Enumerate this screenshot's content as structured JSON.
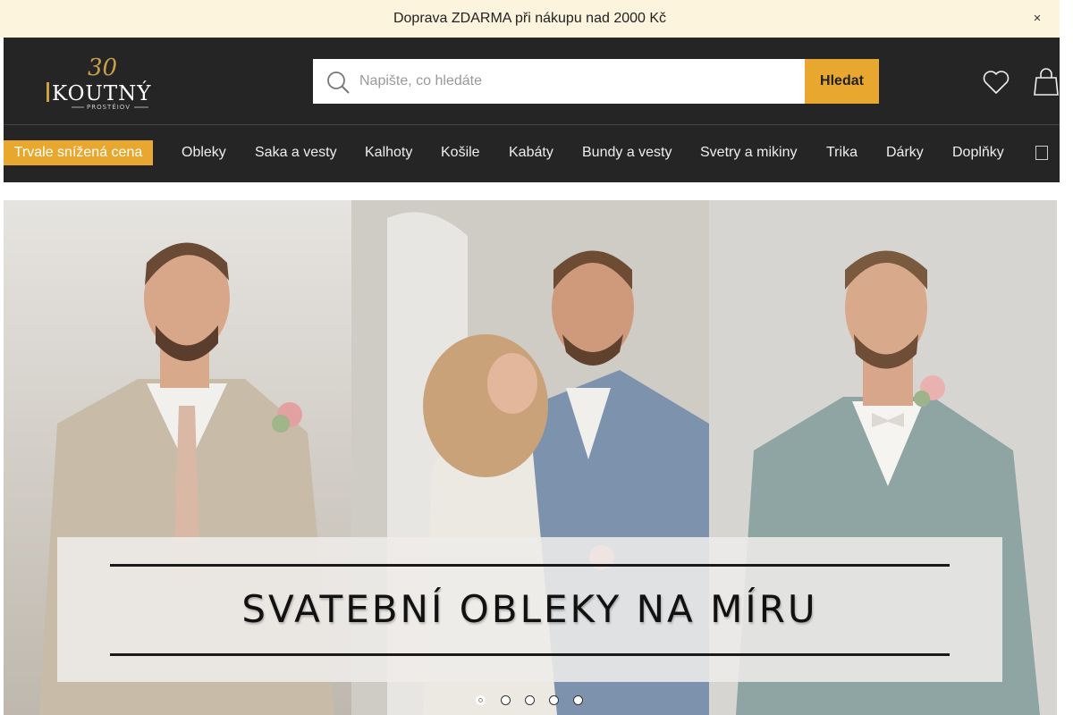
{
  "announcement": {
    "text": "Doprava ZDARMA při nákupu nad 2000 Kč",
    "close_icon": "close-icon"
  },
  "logo": {
    "number": "30",
    "brand": "KOUTNÝ",
    "city": "PROSTĚJOV"
  },
  "search": {
    "placeholder": "Napište, co hledáte",
    "button_label": "Hledat"
  },
  "header_icons": {
    "wishlist": "heart-icon",
    "cart": "shopping-bag-icon"
  },
  "nav": {
    "promo_label": "Trvale snížená cena",
    "items": [
      "Obleky",
      "Saka a vesty",
      "Kalhoty",
      "Košile",
      "Kabáty",
      "Bundy a vesty",
      "Svetry a mikiny",
      "Trika",
      "Dárky",
      "Doplňky"
    ],
    "more_icon": "more-icon"
  },
  "hero": {
    "title": "SVATEBNÍ OBLEKY NA MÍRU",
    "slides_count": 5,
    "active_slide": 1
  },
  "colors": {
    "accent": "#e8a830",
    "header_bg": "#252525",
    "announcement_bg": "#fdf4de"
  }
}
